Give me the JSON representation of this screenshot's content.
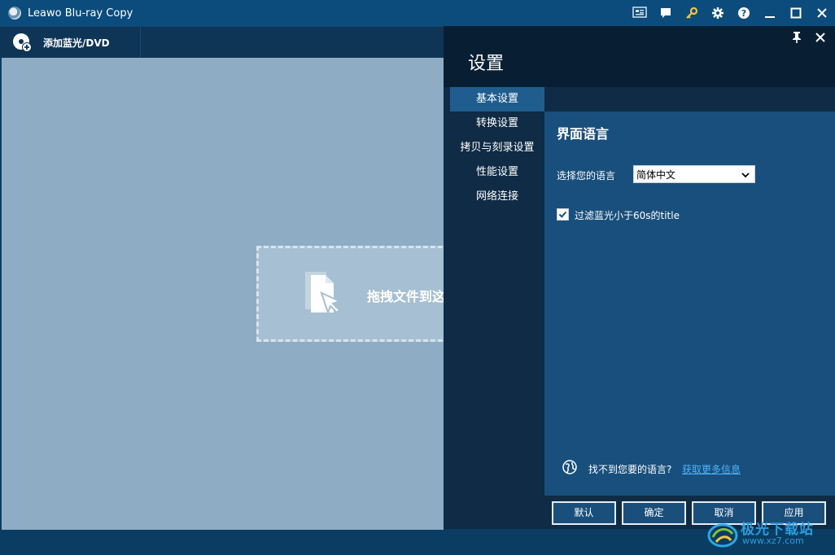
{
  "window": {
    "title": "Leawo Blu-ray Copy",
    "title_icons": [
      "screen-icon",
      "chat-icon",
      "key-icon",
      "gear-icon",
      "help-icon",
      "minimize-icon",
      "maximize-icon",
      "close-icon"
    ]
  },
  "toolbar": {
    "add_label": "添加蓝光/DVD"
  },
  "workarea": {
    "drop_text": "拖拽文件到这"
  },
  "settings": {
    "title": "设置",
    "nav": [
      {
        "label": "基本设置",
        "active": true
      },
      {
        "label": "转换设置",
        "active": false
      },
      {
        "label": "拷贝与刻录设置",
        "active": false
      },
      {
        "label": "性能设置",
        "active": false
      },
      {
        "label": "网络连接",
        "active": false
      }
    ],
    "section_title": "界面语言",
    "language_label": "选择您的语言",
    "language_value": "简体中文",
    "filter_checked": true,
    "filter_label": "过滤蓝光小于60s的title",
    "help_text": "找不到您要的语言?",
    "help_link": "获取更多信息",
    "buttons": {
      "default": "默认",
      "ok": "确定",
      "cancel": "取消",
      "apply": "应用"
    }
  },
  "watermark": {
    "line1": "极光下载站",
    "line2": "www.xz7.com"
  },
  "colors": {
    "titlebar": "#0b4c7c",
    "workarea": "#8eadc4",
    "panel": "#0f2b45",
    "panel_active": "#1f5d8f",
    "content": "#194f7c",
    "link": "#4fb3ff",
    "key_icon": "#f4c542"
  }
}
